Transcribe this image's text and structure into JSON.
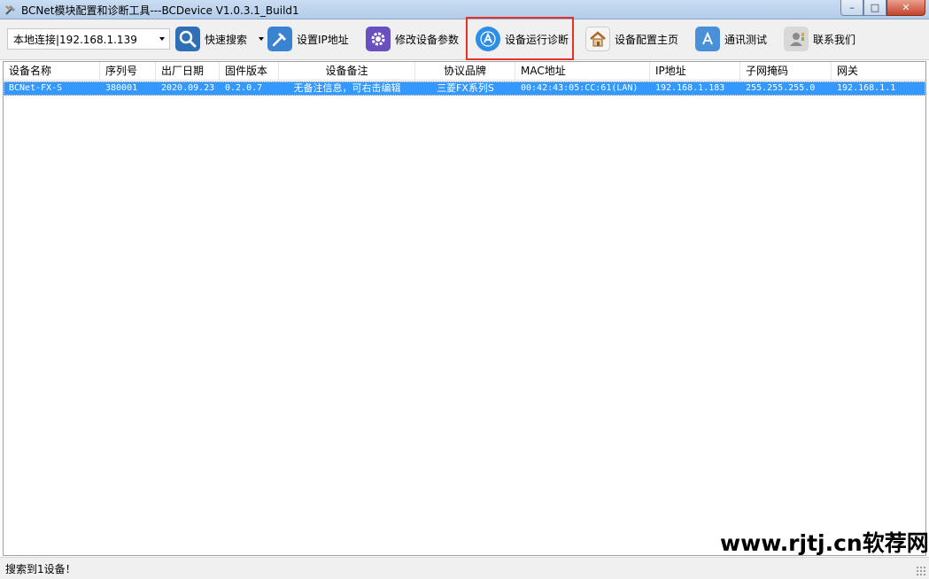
{
  "window": {
    "title": "BCNet模块配置和诊断工具---BCDevice V1.0.3.1_Build1",
    "controls": {
      "minimize": "–",
      "maximize": "□",
      "close": "✕"
    }
  },
  "toolbar": {
    "connection": "本地连接|192.168.1.139",
    "buttons": [
      {
        "label": "快速搜索",
        "icon": "magnifier-icon",
        "color": "#2f6fb7"
      },
      {
        "label": "设置IP地址",
        "icon": "hammer-icon",
        "color": "#3a83cf"
      },
      {
        "label": "修改设备参数",
        "icon": "gear-icon",
        "color": "#6a4fbf"
      },
      {
        "label": "设备运行诊断",
        "icon": "app-store-icon",
        "color": "#2d8ee8"
      },
      {
        "label": "设备配置主页",
        "icon": "home-icon",
        "color": "#b5651d"
      },
      {
        "label": "通讯测试",
        "icon": "app-store-icon",
        "color": "#4a90d9"
      },
      {
        "label": "联系我们",
        "icon": "contacts-icon",
        "color": "#8a8a8a"
      }
    ]
  },
  "table": {
    "columns": [
      "设备名称",
      "序列号",
      "出厂日期",
      "固件版本",
      "设备备注",
      "协议品牌",
      "MAC地址",
      "IP地址",
      "子网掩码",
      "网关"
    ],
    "rows": [
      [
        "BCNet-FX-S",
        "380001",
        "2020.09.23",
        "0.2.0.7",
        "无备注信息，可右击编辑",
        "三菱FX系列S",
        "00:42:43:05:CC:61(LAN)",
        "192.168.1.183",
        "255.255.255.0",
        "192.168.1.1"
      ]
    ],
    "selection_color": "#3399ff"
  },
  "watermark": "www.rjtj.cn软荐网",
  "status": "搜索到1设备！"
}
